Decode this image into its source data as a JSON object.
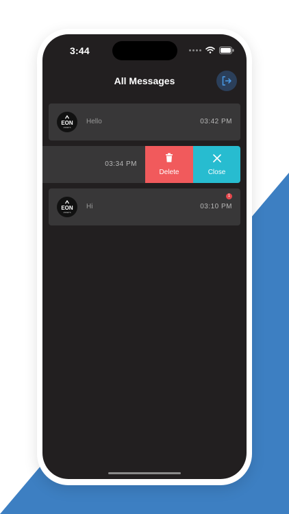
{
  "status_bar": {
    "time": "3:44"
  },
  "header": {
    "title": "All Messages",
    "logout_icon": "logout-icon",
    "accent": "#2b3f5a"
  },
  "messages": [
    {
      "text": "Hello",
      "time": "03:42 PM",
      "avatar_brand": "EON",
      "avatar_sub": "ASSETS"
    },
    {
      "time": "03:34 PM",
      "swipe_actions": [
        {
          "label": "Delete",
          "icon": "trash-icon",
          "color": "#f15a5c"
        },
        {
          "label": "Close",
          "icon": "close-icon",
          "color": "#27bcd0"
        }
      ]
    },
    {
      "text": "Hi",
      "time": "03:10 PM",
      "badge": "1",
      "avatar_brand": "EON",
      "avatar_sub": "ASSETS"
    }
  ],
  "colors": {
    "background_shape": "#3d7fc2",
    "screen": "#221f20",
    "card": "#383738"
  }
}
